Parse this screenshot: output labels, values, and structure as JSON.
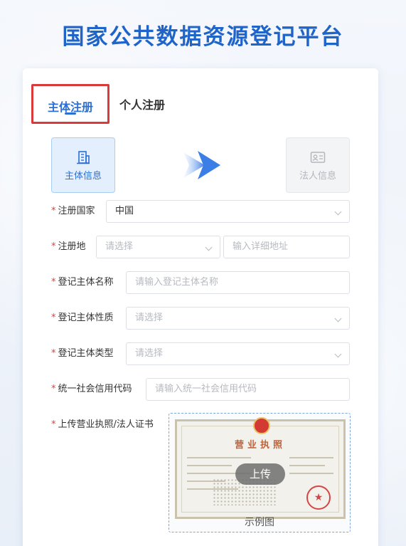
{
  "page": {
    "title": "国家公共数据资源登记平台"
  },
  "tabs": [
    {
      "label": "主体注册",
      "active": true
    },
    {
      "label": "个人注册",
      "active": false
    }
  ],
  "steps": [
    {
      "label": "主体信息",
      "active": true,
      "icon": "building-icon"
    },
    {
      "label": "法人信息",
      "active": false,
      "icon": "id-card-icon"
    }
  ],
  "form": {
    "required_mark": "*",
    "country": {
      "label": "注册国家",
      "value": "中国"
    },
    "location": {
      "label": "注册地",
      "select_placeholder": "请选择",
      "address_placeholder": "输入详细地址"
    },
    "entity_name": {
      "label": "登记主体名称",
      "placeholder": "请输入登记主体名称"
    },
    "entity_nature": {
      "label": "登记主体性质",
      "placeholder": "请选择"
    },
    "entity_type": {
      "label": "登记主体类型",
      "placeholder": "请选择"
    },
    "credit_code": {
      "label": "统一社会信用代码",
      "placeholder": "请输入统一社会信用代码"
    },
    "upload": {
      "label": "上传营业执照/法人证书",
      "button": "上传",
      "sample_caption": "示例图",
      "license_title": "营业执照"
    }
  },
  "colors": {
    "accent": "#2c6fd6",
    "title": "#1f64c8",
    "required": "#e0403b",
    "highlight_box": "#d93a3a"
  }
}
